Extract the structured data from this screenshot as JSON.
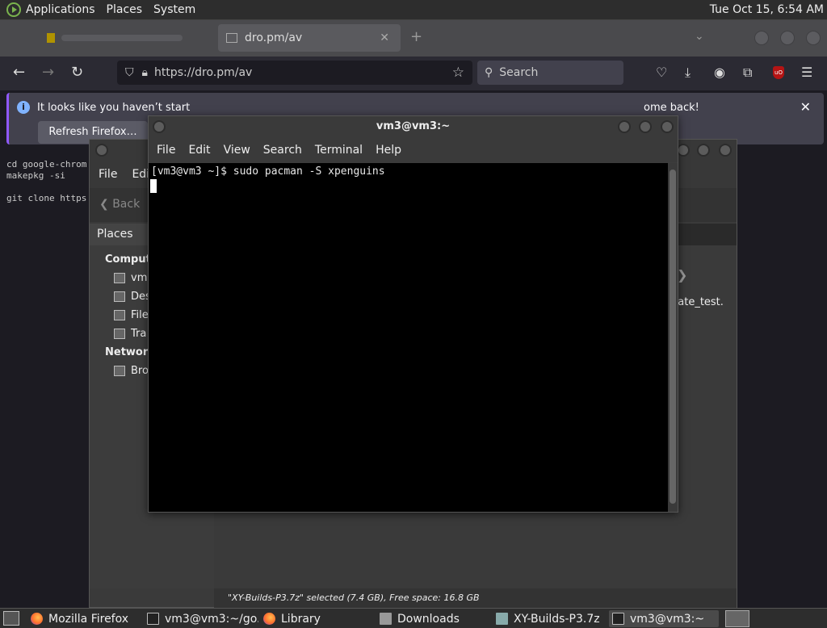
{
  "top_panel": {
    "menus": [
      "Applications",
      "Places",
      "System"
    ],
    "clock": "Tue Oct 15,  6:54 AM"
  },
  "firefox": {
    "active_tab": "dro.pm/av",
    "url": "https://dro.pm/av",
    "search_placeholder": "Search",
    "notice": {
      "text": "It looks like you haven’t start",
      "text_end": "ome back!",
      "button": "Refresh Firefox…"
    },
    "page_lines": [
      "cd google-chrom",
      "makepkg -si",
      "",
      "git clone https"
    ]
  },
  "file_manager": {
    "menus": [
      "File",
      "Edi"
    ],
    "back_label": "Back",
    "places_header": "Places",
    "sections": [
      {
        "label": "Compute",
        "items": [
          "vm",
          "Des",
          "File",
          "Tra"
        ]
      },
      {
        "label": "Network",
        "items": [
          "Bro"
        ]
      }
    ],
    "visible_file": "date_test.",
    "status": "\"XY-Builds-P3.7z\" selected (7.4 GB), Free space: 16.8 GB"
  },
  "terminal": {
    "title": "vm3@vm3:~",
    "menus": [
      "File",
      "Edit",
      "View",
      "Search",
      "Terminal",
      "Help"
    ],
    "line": "[vm3@vm3 ~]$ sudo pacman -S xpenguins"
  },
  "taskbar": {
    "tasks": [
      {
        "label": "Mozilla Firefox",
        "icon": "firefox-icon"
      },
      {
        "label": "vm3@vm3:~/go...",
        "icon": "terminal-icon"
      },
      {
        "label": "Library",
        "icon": "firefox-icon"
      },
      {
        "label": "Downloads",
        "icon": "folder-icon"
      },
      {
        "label": "XY-Builds-P3.7z",
        "icon": "archive-icon"
      },
      {
        "label": "vm3@vm3:~",
        "icon": "terminal-icon"
      }
    ]
  }
}
